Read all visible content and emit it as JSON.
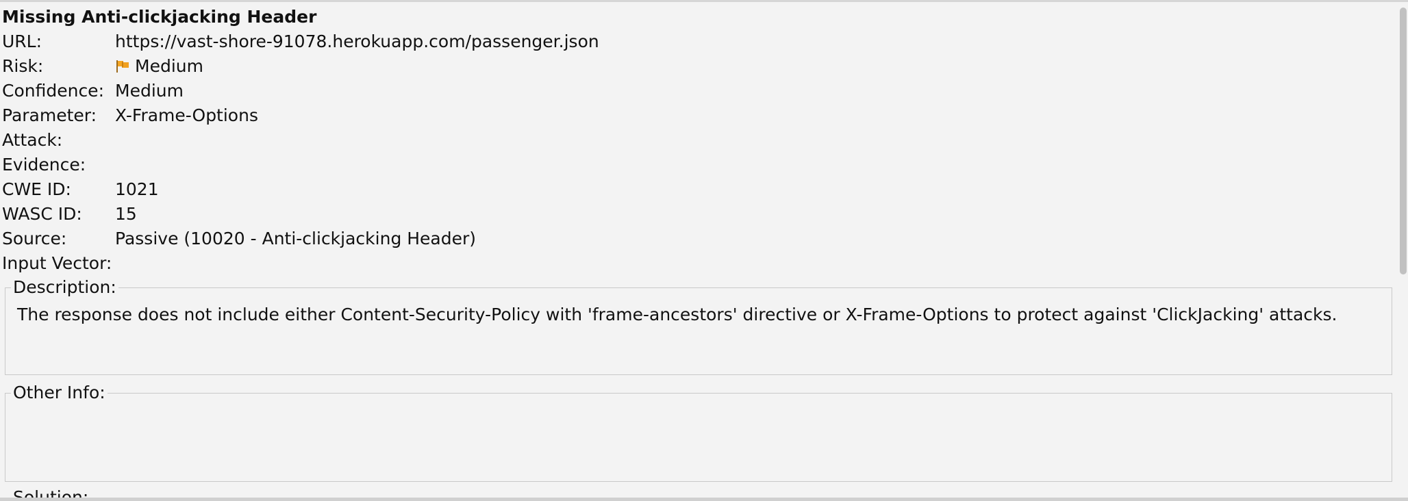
{
  "alert": {
    "title": "Missing Anti-clickjacking Header",
    "fields": {
      "url": {
        "label": "URL:",
        "value": "https://vast-shore-91078.herokuapp.com/passenger.json"
      },
      "risk": {
        "label": "Risk:",
        "value": "Medium",
        "icon": "orange-flag-icon",
        "icon_color": "#f5a623"
      },
      "confidence": {
        "label": "Confidence:",
        "value": "Medium"
      },
      "parameter": {
        "label": "Parameter:",
        "value": "X-Frame-Options"
      },
      "attack": {
        "label": "Attack:",
        "value": ""
      },
      "evidence": {
        "label": "Evidence:",
        "value": ""
      },
      "cwe_id": {
        "label": "CWE ID:",
        "value": "1021"
      },
      "wasc_id": {
        "label": "WASC ID:",
        "value": "15"
      },
      "source": {
        "label": "Source:",
        "value": "Passive (10020 - Anti-clickjacking Header)"
      },
      "input_vector": {
        "label": "Input Vector:",
        "value": ""
      }
    },
    "description": {
      "label": "Description:",
      "text": "The response does not include either Content-Security-Policy with 'frame-ancestors' directive or X-Frame-Options to protect against 'ClickJacking' attacks."
    },
    "other_info": {
      "label": "Other Info:",
      "text": ""
    },
    "solution": {
      "label": "Solution:"
    }
  }
}
